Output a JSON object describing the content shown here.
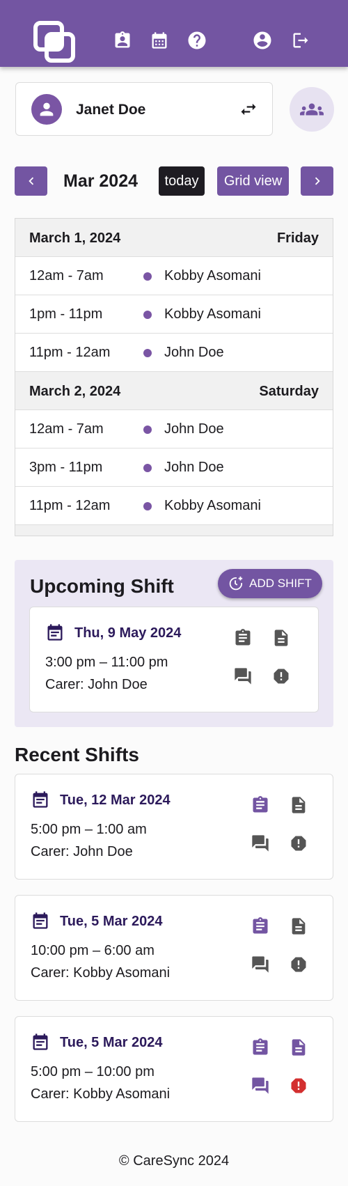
{
  "header": {
    "icons": [
      "logo-icon",
      "carer-badge-icon",
      "calendar-icon",
      "help-icon",
      "account-icon",
      "logout-icon"
    ]
  },
  "client": {
    "name": "Janet Doe"
  },
  "calendar": {
    "month": "Mar 2024",
    "today_label": "today",
    "grid_label": "Grid view",
    "days": [
      {
        "date": "March 1, 2024",
        "weekday": "Friday",
        "events": [
          {
            "time": "12am - 7am",
            "name": "Kobby Asomani"
          },
          {
            "time": "1pm - 11pm",
            "name": "Kobby Asomani"
          },
          {
            "time": "11pm - 12am",
            "name": "John Doe"
          }
        ]
      },
      {
        "date": "March 2, 2024",
        "weekday": "Saturday",
        "events": [
          {
            "time": "12am - 7am",
            "name": "John Doe"
          },
          {
            "time": "3pm - 11pm",
            "name": "John Doe"
          },
          {
            "time": "11pm - 12am",
            "name": "Kobby Asomani"
          }
        ]
      }
    ]
  },
  "upcoming": {
    "title": "Upcoming Shift",
    "add_label": "ADD SHIFT",
    "shift": {
      "date": "Thu, 9 May 2024",
      "time": "3:00 pm – 11:00 pm",
      "carer": "Carer: John Doe"
    }
  },
  "recent": {
    "title": "Recent Shifts",
    "shifts": [
      {
        "date": "Tue, 12 Mar 2024",
        "time": "5:00 pm – 1:00 am",
        "carer": "Carer: John Doe"
      },
      {
        "date": "Tue, 5 Mar 2024",
        "time": "10:00 pm – 6:00 am",
        "carer": "Carer: Kobby Asomani"
      },
      {
        "date": "Tue, 5 Mar 2024",
        "time": "5:00 pm – 10:00 pm",
        "carer": "Carer: Kobby Asomani"
      }
    ]
  },
  "footer": {
    "text": "© CareSync 2024"
  },
  "colors": {
    "brand": "#7355a2",
    "accent_light": "#ebe7f4",
    "dot": "#7a55a4",
    "alert": "#d32f2f",
    "icon_grey": "#555555",
    "dark_purple": "#2c1a5b"
  }
}
